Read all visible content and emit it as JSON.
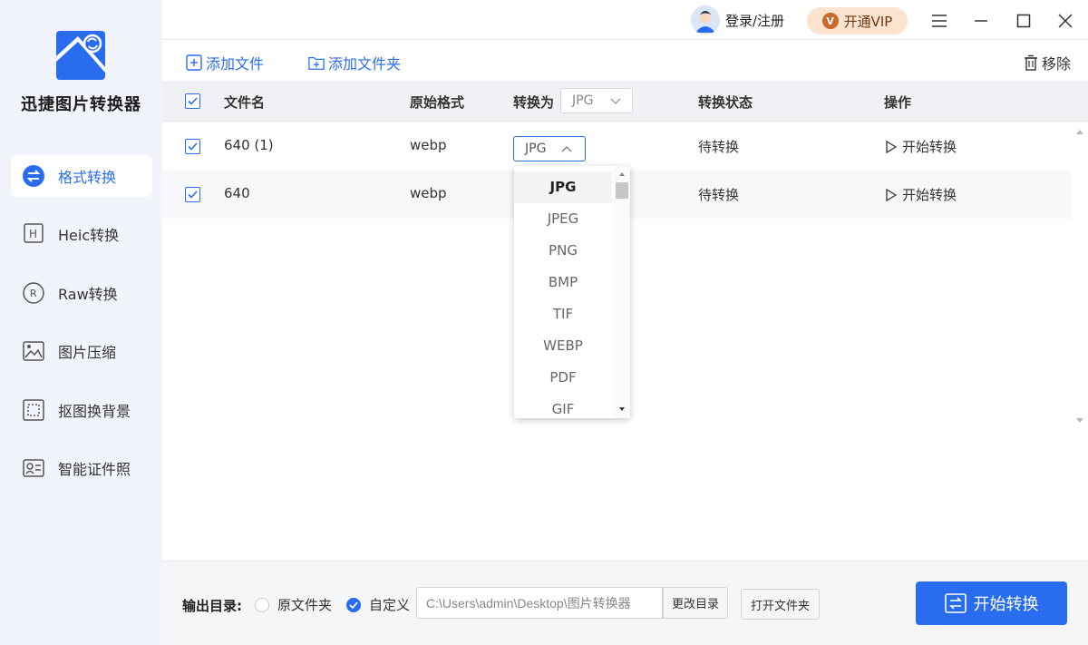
{
  "app": {
    "name": "迅捷图片转换器"
  },
  "sidebar": {
    "items": [
      {
        "label": "格式转换",
        "active": true
      },
      {
        "label": "Heic转换"
      },
      {
        "label": "Raw转换"
      },
      {
        "label": "图片压缩"
      },
      {
        "label": "抠图换背景"
      },
      {
        "label": "智能证件照"
      }
    ]
  },
  "titlebar": {
    "login_label": "登录/注册",
    "vip_label": "开通VIP",
    "vip_badge": "V"
  },
  "toolbar": {
    "add_file": "添加文件",
    "add_folder": "添加文件夹",
    "remove": "移除"
  },
  "table": {
    "headers": {
      "filename": "文件名",
      "original_format": "原始格式",
      "convert_to": "转换为",
      "status": "转换状态",
      "action": "操作"
    },
    "global_format": "JPG",
    "rows": [
      {
        "filename": "640 (1)",
        "format": "webp",
        "target": "JPG",
        "status": "待转换",
        "action": "开始转换",
        "checked": true
      },
      {
        "filename": "640",
        "format": "webp",
        "target": "JPG",
        "status": "待转换",
        "action": "开始转换",
        "checked": true
      }
    ]
  },
  "dropdown": {
    "options": [
      "JPG",
      "JPEG",
      "PNG",
      "BMP",
      "TIF",
      "WEBP",
      "PDF",
      "GIF"
    ],
    "selected": "JPG"
  },
  "output": {
    "label": "输出目录:",
    "option_original": "原文件夹",
    "option_custom": "自定义",
    "path": "C:\\Users\\admin\\Desktop\\图片转换器",
    "change_dir": "更改目录",
    "open_folder": "打开文件夹",
    "start": "开始转换"
  },
  "colors": {
    "accent": "#2a6cf0",
    "sidebar_bg": "#f1f5fb",
    "vip_bg": "#fbe3cf"
  }
}
